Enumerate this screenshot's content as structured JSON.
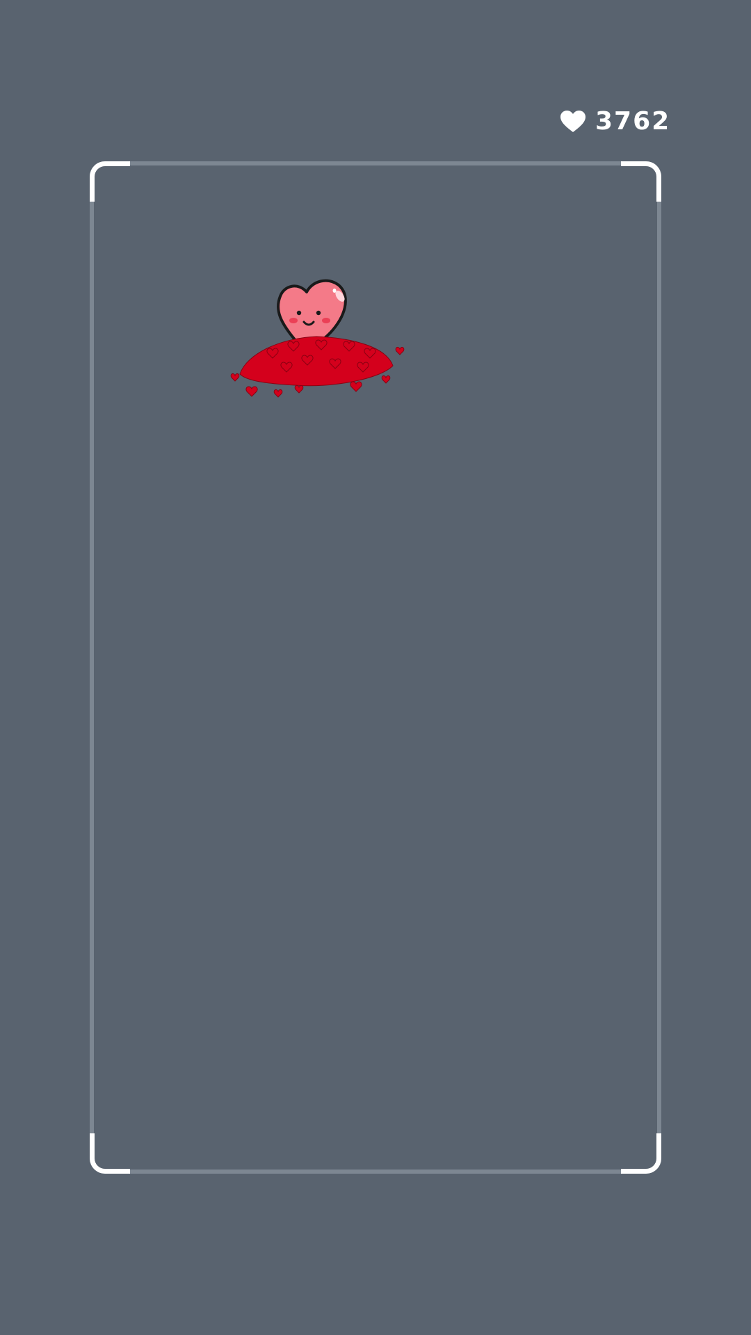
{
  "counter": {
    "icon": "heart-icon",
    "value": "3762"
  },
  "colors": {
    "background": "#59636f",
    "frame_border": "#7d8792",
    "frame_corners": "#ffffff",
    "heart_pink": "#f07a88",
    "heart_red": "#d4001c"
  },
  "scene": {
    "mascot": "smiling-heart-on-heart-pile"
  }
}
